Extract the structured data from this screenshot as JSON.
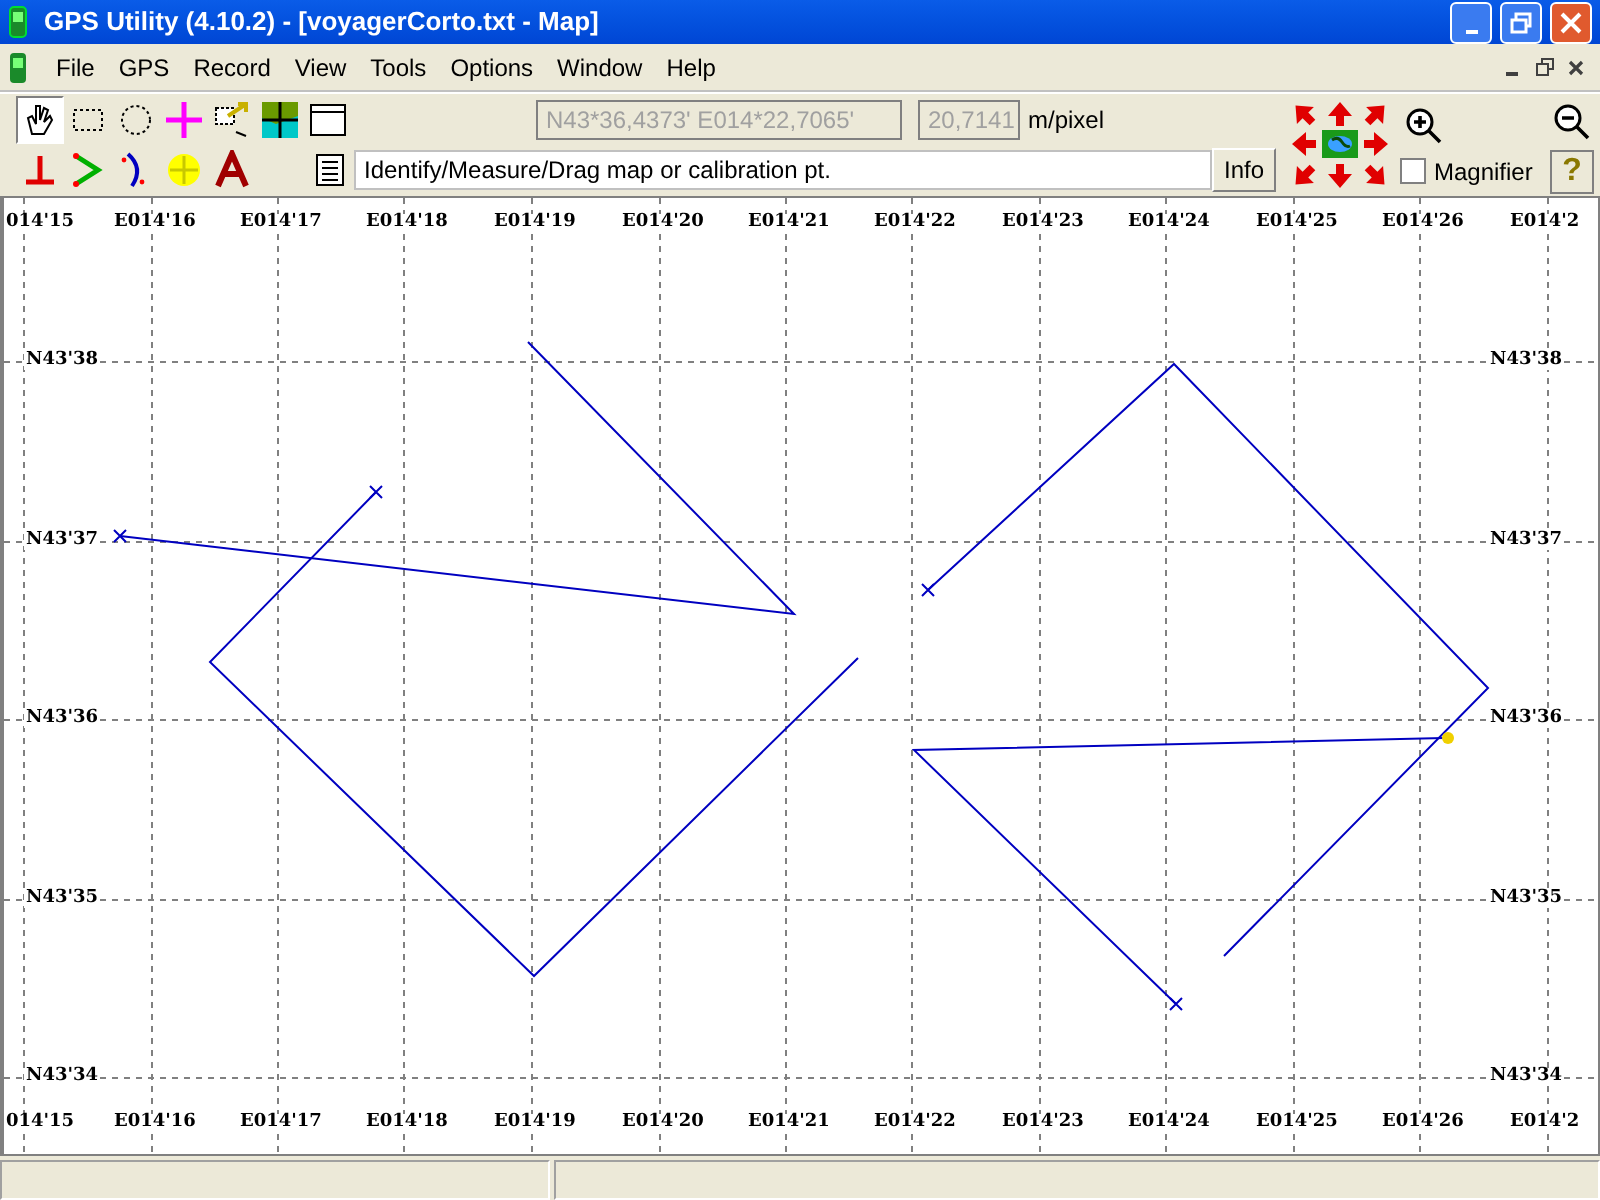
{
  "window": {
    "title": "GPS Utility (4.10.2) - [voyagerCorto.txt - Map]"
  },
  "menu": [
    "File",
    "GPS",
    "Record",
    "View",
    "Tools",
    "Options",
    "Window",
    "Help"
  ],
  "toolbar": {
    "tools": [
      {
        "kind": "hand",
        "selected": true
      },
      {
        "kind": "rect",
        "selected": false
      },
      {
        "kind": "circle",
        "selected": false
      },
      {
        "kind": "cross",
        "selected": false
      },
      {
        "kind": "arrowbox",
        "selected": false
      },
      {
        "kind": "mapimg",
        "selected": false
      },
      {
        "kind": "table",
        "selected": false
      }
    ],
    "tools_row2": [
      {
        "kind": "perp",
        "selected": false
      },
      {
        "kind": "angle",
        "selected": false
      },
      {
        "kind": "curve",
        "selected": false
      },
      {
        "kind": "target",
        "selected": false
      },
      {
        "kind": "letter",
        "selected": false
      }
    ],
    "coordinates": "N43*36,4373' E014*22,7065'",
    "scale": "20,7141",
    "scale_unit": "m/pixel",
    "hint": "Identify/Measure/Drag map or calibration pt.",
    "info_button": "Info",
    "magnifier": {
      "label": "Magnifier",
      "checked": false
    },
    "help_button": "?"
  },
  "map": {
    "top_labels": [
      "014'15",
      "E014'16",
      "E014'17",
      "E014'18",
      "E014'19",
      "E014'20",
      "E014'21",
      "E014'22",
      "E014'23",
      "E014'24",
      "E014'25",
      "E014'26",
      "E014'2"
    ],
    "bottom_labels": [
      "014'15",
      "E014'16",
      "E014'17",
      "E014'18",
      "E014'19",
      "E014'20",
      "E014'21",
      "E014'22",
      "E014'23",
      "E014'24",
      "E014'25",
      "E014'26",
      "E014'2"
    ],
    "left_labels": [
      "N43'38",
      "N43'37",
      "N43'36",
      "N43'35",
      "N43'34"
    ],
    "right_labels": [
      "N43'38",
      "N43'37",
      "N43'36",
      "N43'35",
      "N43'34"
    ]
  }
}
